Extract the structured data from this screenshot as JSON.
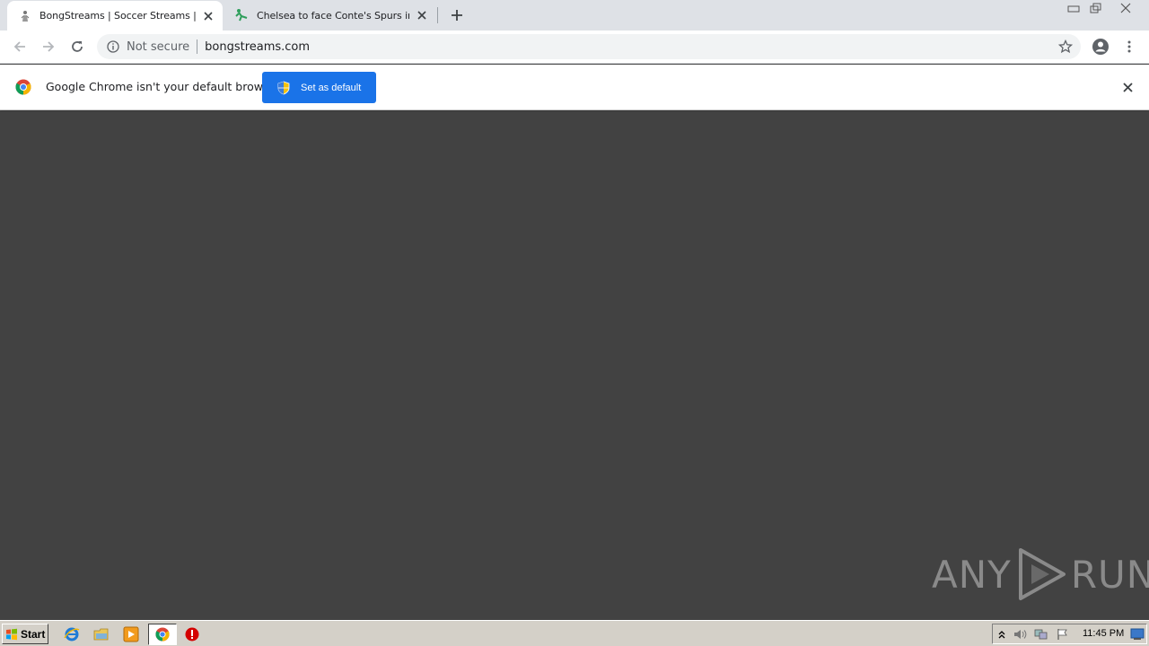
{
  "browser": {
    "tabs": [
      {
        "title": "BongStreams | Soccer Streams | NBA Streams",
        "favicon": "person-icon",
        "active": true
      },
      {
        "title": "Chelsea to face Conte's Spurs in EFL Cup",
        "favicon": "kick-icon",
        "active": false
      }
    ],
    "address": {
      "security_label": "Not secure",
      "url": "bongstreams.com"
    }
  },
  "infobar": {
    "message": "Google Chrome isn't your default browser",
    "button_label": "Set as default"
  },
  "watermark": {
    "left": "ANY",
    "right": "RUN"
  },
  "taskbar": {
    "start_label": "Start",
    "clock": "11:45 PM"
  },
  "colors": {
    "accent": "#1a73e8",
    "content_bg": "#424242",
    "tabstrip_bg": "#dee1e6",
    "taskbar_bg": "#d4d0c8"
  }
}
